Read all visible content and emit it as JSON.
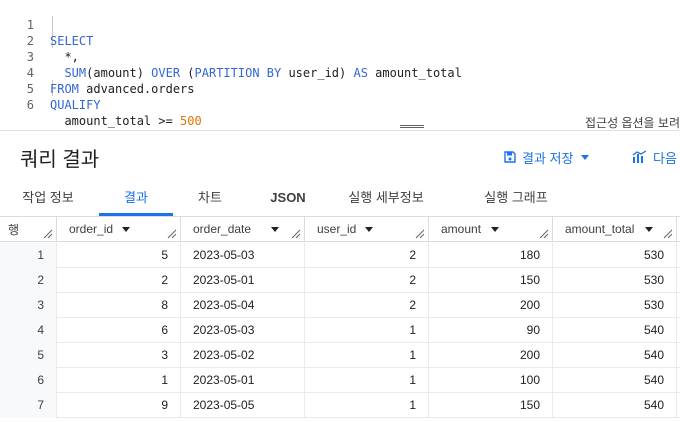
{
  "editor": {
    "lines": [
      {
        "num": "1",
        "parts": [
          {
            "t": "SELECT",
            "c": "kw"
          }
        ]
      },
      {
        "num": "2",
        "parts": [
          {
            "t": "  *,",
            "c": "id"
          }
        ]
      },
      {
        "num": "3",
        "parts": [
          {
            "t": "  ",
            "c": "id"
          },
          {
            "t": "SUM",
            "c": "fn"
          },
          {
            "t": "(amount) ",
            "c": "id"
          },
          {
            "t": "OVER",
            "c": "kw"
          },
          {
            "t": " (",
            "c": "id"
          },
          {
            "t": "PARTITION BY",
            "c": "kw"
          },
          {
            "t": " user_id) ",
            "c": "id"
          },
          {
            "t": "AS",
            "c": "kw"
          },
          {
            "t": " amount_total",
            "c": "id"
          }
        ]
      },
      {
        "num": "4",
        "parts": [
          {
            "t": "FROM",
            "c": "kw"
          },
          {
            "t": " advanced.orders",
            "c": "id"
          }
        ]
      },
      {
        "num": "5",
        "parts": [
          {
            "t": "QUALIFY",
            "c": "kw"
          }
        ]
      },
      {
        "num": "6",
        "parts": [
          {
            "t": "  amount_total >= ",
            "c": "id"
          },
          {
            "t": "500",
            "c": "num"
          }
        ]
      }
    ],
    "accessibility_hint": "접근성 옵션을 보려"
  },
  "results": {
    "title": "쿼리 결과",
    "save_label": "결과 저장",
    "explore_label": "다음"
  },
  "tabs": [
    {
      "label": "작업 정보"
    },
    {
      "label": "결과"
    },
    {
      "label": "차트"
    },
    {
      "label": "JSON"
    },
    {
      "label": "실행 세부정보"
    },
    {
      "label": "실행 그래프"
    }
  ],
  "table": {
    "rownum_header": "행",
    "columns": [
      "order_id",
      "order_date",
      "user_id",
      "amount",
      "amount_total"
    ],
    "rows": [
      {
        "n": "1",
        "cells": [
          "5",
          "2023-05-03",
          "2",
          "180",
          "530"
        ]
      },
      {
        "n": "2",
        "cells": [
          "2",
          "2023-05-01",
          "2",
          "150",
          "530"
        ]
      },
      {
        "n": "3",
        "cells": [
          "8",
          "2023-05-04",
          "2",
          "200",
          "530"
        ]
      },
      {
        "n": "4",
        "cells": [
          "6",
          "2023-05-03",
          "1",
          "90",
          "540"
        ]
      },
      {
        "n": "5",
        "cells": [
          "3",
          "2023-05-02",
          "1",
          "200",
          "540"
        ]
      },
      {
        "n": "6",
        "cells": [
          "1",
          "2023-05-01",
          "1",
          "100",
          "540"
        ]
      },
      {
        "n": "7",
        "cells": [
          "9",
          "2023-05-05",
          "1",
          "150",
          "540"
        ]
      }
    ]
  },
  "colors": {
    "accent": "#1a73e8",
    "keyword": "#3367d6",
    "number": "#e37400"
  }
}
